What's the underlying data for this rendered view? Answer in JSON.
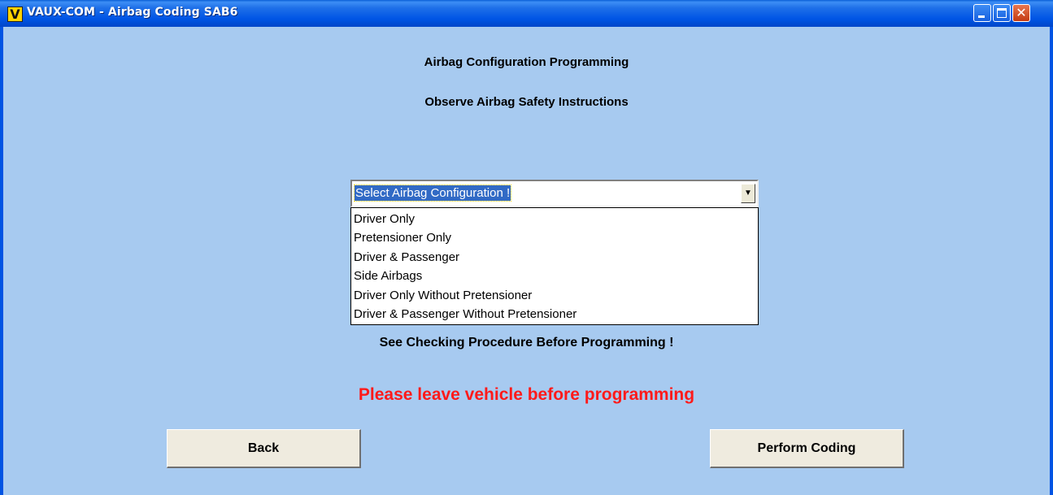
{
  "window": {
    "title": "VAUX-COM - Airbag Coding SAB6",
    "app_icon_letter": "V",
    "controls": [
      "minimize-icon",
      "maximize-icon",
      "close-icon"
    ]
  },
  "main": {
    "heading": "Airbag Configuration Programming",
    "subheading": "Observe Airbag Safety Instructions",
    "select": {
      "selected": "Select Airbag Configuration !",
      "options": [
        "Driver Only",
        "Pretensioner Only",
        "Driver & Passenger",
        "Side Airbags",
        "Driver Only Without Pretensioner",
        "Driver & Passenger Without Pretensioner"
      ]
    },
    "note": "See Checking Procedure Before Programming !",
    "warning": "Please leave vehicle before programming",
    "back_label": "Back",
    "perform_label": "Perform Coding"
  },
  "colors": {
    "client_bg": "#a7caf0",
    "warning_text": "#ff1a1a",
    "titlebar": "#0055e5"
  }
}
